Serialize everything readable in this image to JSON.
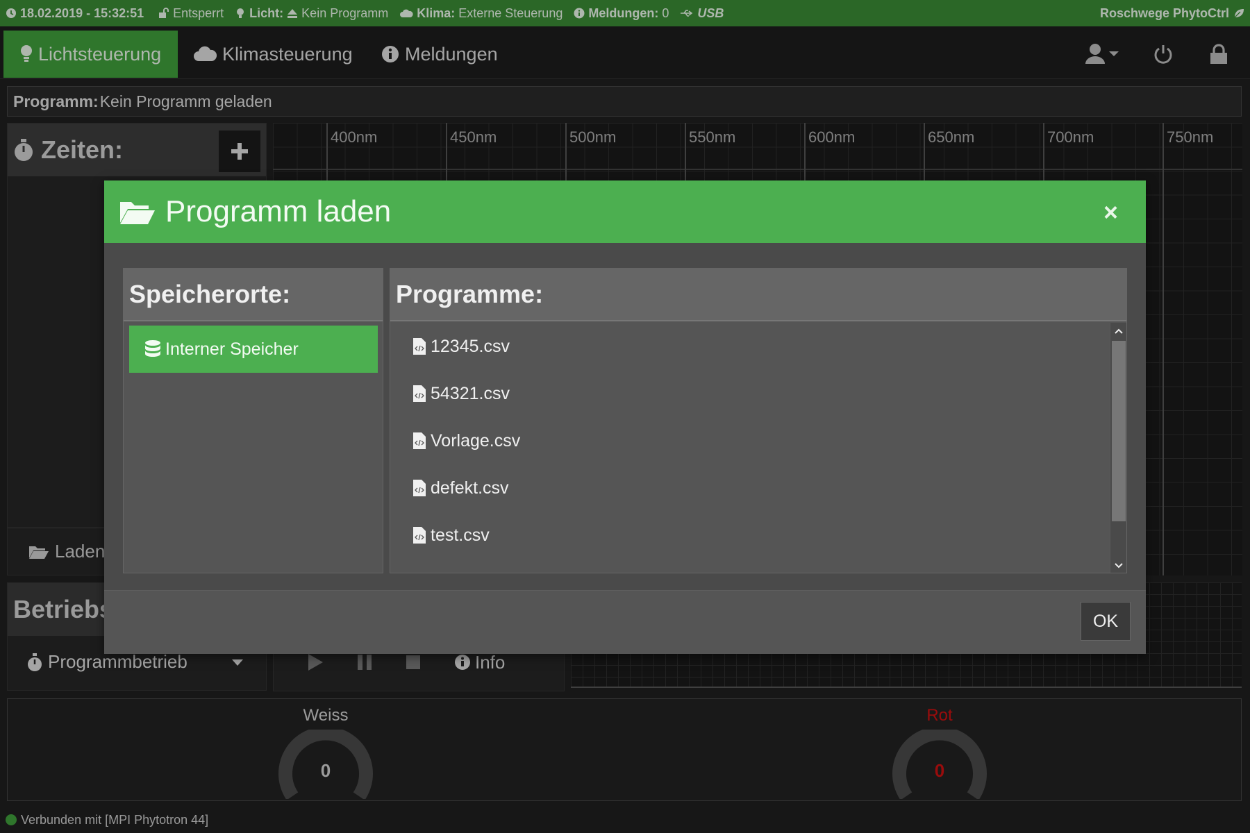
{
  "statusbar": {
    "datetime": "18.02.2019 - 15:32:51",
    "lock_state": "Entsperrt",
    "light_label": "Licht:",
    "light_value": "Kein Programm",
    "climate_label": "Klima:",
    "climate_value": "Externe Steuerung",
    "messages_label": "Meldungen:",
    "messages_count": "0",
    "usb": "USB",
    "brand": "Roschwege PhytoCtrl"
  },
  "nav": {
    "tabs": [
      {
        "label": "Lichtsteuerung",
        "active": true
      },
      {
        "label": "Klimasteuerung",
        "active": false
      },
      {
        "label": "Meldungen",
        "active": false
      }
    ]
  },
  "program": {
    "label": "Programm:",
    "value": "Kein Programm geladen"
  },
  "times_panel": {
    "title": "Zeiten:",
    "load_label": "Laden"
  },
  "spectrum": {
    "labels": [
      "400nm",
      "450nm",
      "500nm",
      "550nm",
      "600nm",
      "650nm",
      "700nm",
      "750nm"
    ]
  },
  "operation": {
    "title": "Betriebs",
    "mode": "Programmbetrieb",
    "info_label": "Info"
  },
  "gauges": [
    {
      "label": "Weiss",
      "value": "0",
      "color": "#cfcfcf"
    },
    {
      "label": "Rot",
      "value": "0",
      "color": "#cc1111"
    }
  ],
  "footer": {
    "connection": "Verbunden mit [MPI Phytotron 44]"
  },
  "modal": {
    "title": "Programm laden",
    "close": "×",
    "storage_title": "Speicherorte:",
    "storage_items": [
      "Interner Speicher"
    ],
    "programs_title": "Programme:",
    "files": [
      "12345.csv",
      "54321.csv",
      "Vorlage.csv",
      "defekt.csv",
      "test.csv",
      ""
    ],
    "ok_label": "OK"
  },
  "colors": {
    "accent": "#4caf50",
    "status_bar": "#3a8a35",
    "danger": "#cc1111"
  }
}
